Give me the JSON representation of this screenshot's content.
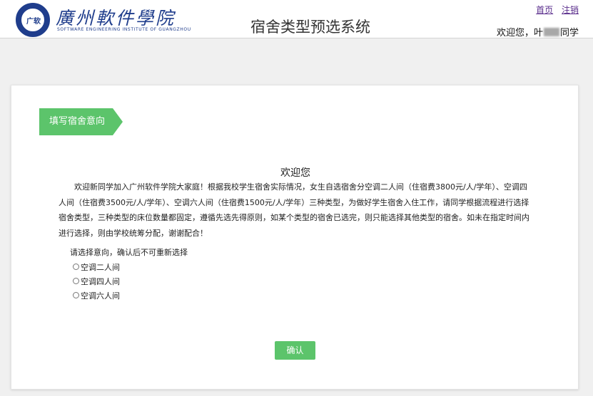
{
  "header": {
    "logo_seal_text": "广软",
    "logo_cn": "廣州軟件學院",
    "logo_en": "SOFTWARE ENGINEERING INSTITUTE OF GUANGZHOU",
    "system_title": "宿舍类型预选系统",
    "links": {
      "home": "首页",
      "logout": "注销"
    },
    "welcome_prefix": "欢迎您，叶",
    "welcome_suffix": "同学"
  },
  "step": {
    "label": "填写宿舍意向"
  },
  "intro": {
    "title": "欢迎您",
    "body": "欢迎新同学加入广州软件学院大家庭！根据我校学生宿舍实际情况，女生自选宿舍分空调二人间（住宿费3800元/人/学年）、空调四人间（住宿费3500元/人/学年）、空调六人间（住宿费1500元/人/学年）三种类型，为做好学生宿舍入住工作，请同学根据流程进行选择宿舍类型，三种类型的床位数量都固定，遵循先选先得原则，如某个类型的宿舍已选完，则只能选择其他类型的宿舍。如未在指定时间内进行选择，则由学校统筹分配，谢谢配合！"
  },
  "form": {
    "prompt": "请选择意向，确认后不可重新选择",
    "options": [
      "空调二人间",
      "空调四人间",
      "空调六人间"
    ],
    "confirm_label": "确认"
  },
  "colors": {
    "accent_green": "#5cc46b",
    "brand_blue": "#1f3d8c",
    "link_purple": "#5a2d8c",
    "page_background": "#f0f0f0"
  }
}
